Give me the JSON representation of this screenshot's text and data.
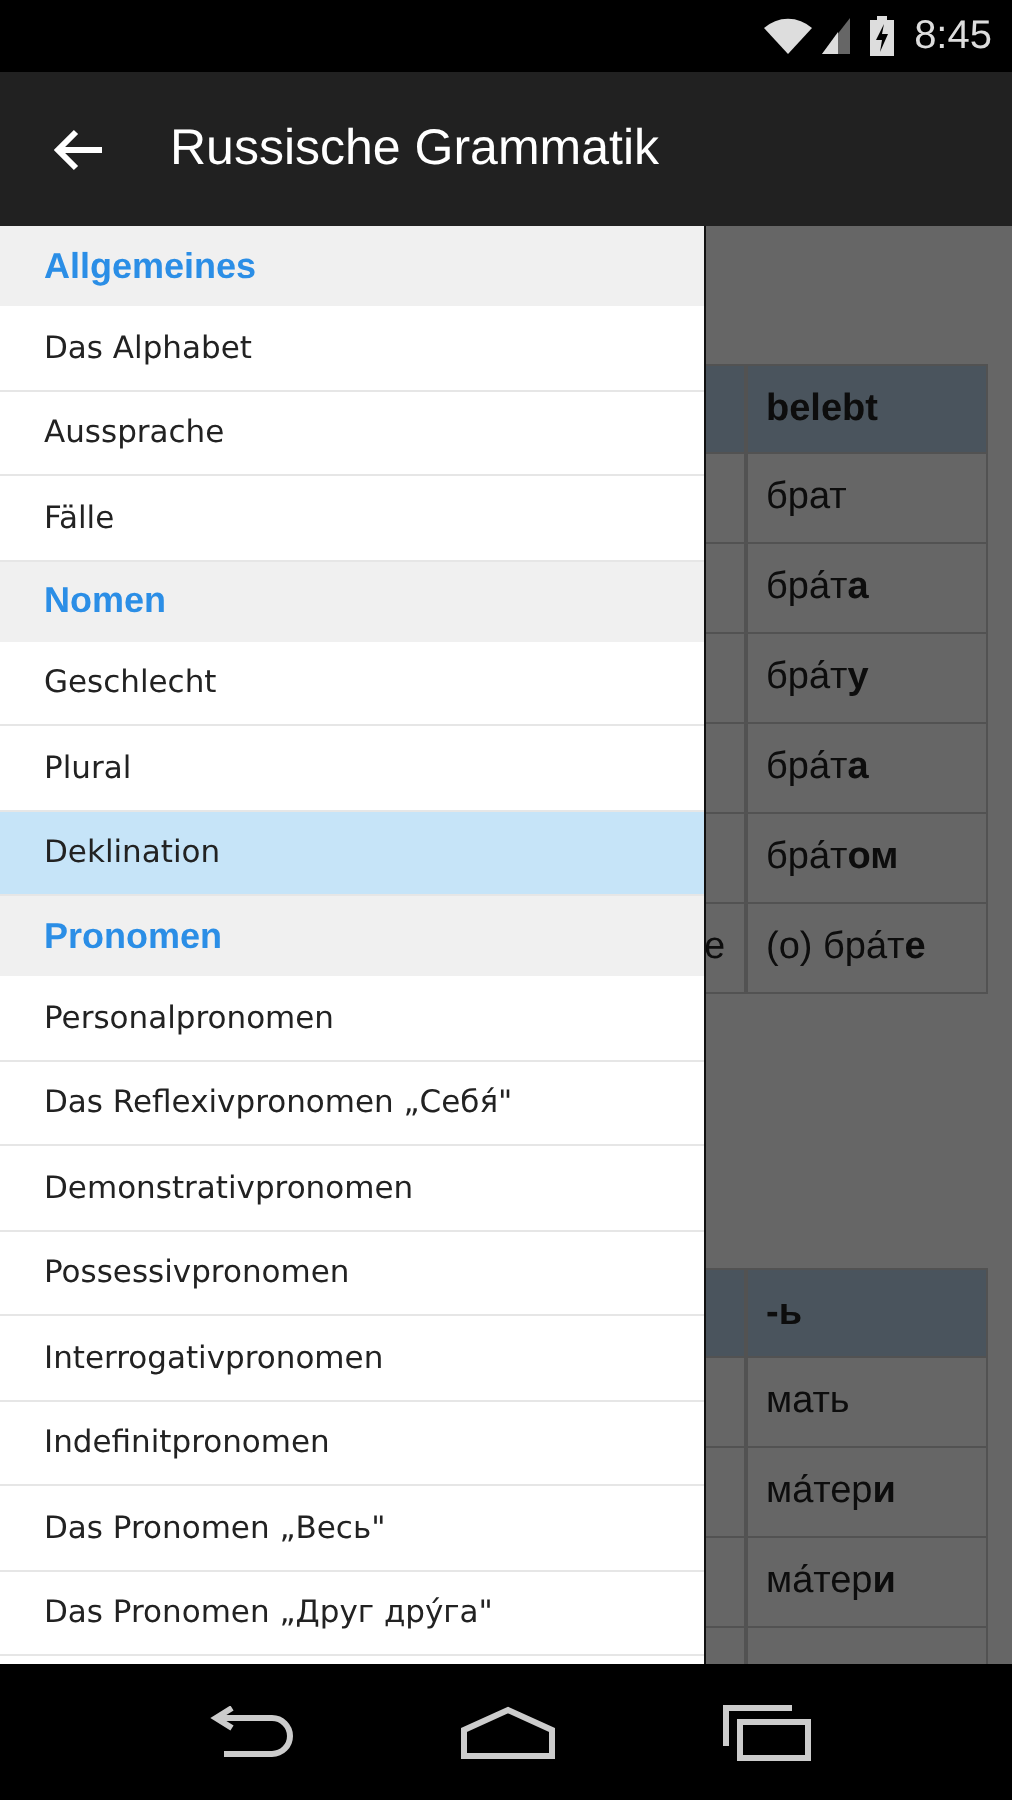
{
  "status_bar": {
    "time": "8:45"
  },
  "app_bar": {
    "title": "Russische Grammatik"
  },
  "content": {
    "tables": [
      {
        "header": {
          "column_2": "belebt"
        },
        "rows": [
          {
            "column_2": "брат"
          },
          {
            "column_2": "бра́т**а**"
          },
          {
            "column_2": "бра́т**у**"
          },
          {
            "column_2": "бра́т**а**"
          },
          {
            "column_2": "бра́т**ом**"
          },
          {
            "column_1": "e",
            "column_2": "(о) бра́т**е**"
          }
        ]
      },
      {
        "header": {
          "column_2": "-ь"
        },
        "rows": [
          {
            "column_2": "мать"
          },
          {
            "column_2": "ма́тер**и**"
          },
          {
            "column_2": "ма́тер**и**"
          },
          {}
        ]
      }
    ]
  },
  "drawer": {
    "items": [
      {
        "kind": "section",
        "label": "Allgemeines"
      },
      {
        "kind": "entry",
        "label": "Das Alphabet",
        "selected": false
      },
      {
        "kind": "entry",
        "label": "Aussprache",
        "selected": false
      },
      {
        "kind": "entry",
        "label": "Fälle",
        "selected": false
      },
      {
        "kind": "section",
        "label": "Nomen"
      },
      {
        "kind": "entry",
        "label": "Geschlecht",
        "selected": false
      },
      {
        "kind": "entry",
        "label": "Plural",
        "selected": false
      },
      {
        "kind": "entry",
        "label": "Deklination",
        "selected": true
      },
      {
        "kind": "section",
        "label": "Pronomen"
      },
      {
        "kind": "entry",
        "label": "Personalpronomen",
        "selected": false
      },
      {
        "kind": "entry",
        "label": "Das Reflexivpronomen „Себя́\"",
        "selected": false
      },
      {
        "kind": "entry",
        "label": "Demonstrativpronomen",
        "selected": false
      },
      {
        "kind": "entry",
        "label": "Possessivpronomen",
        "selected": false
      },
      {
        "kind": "entry",
        "label": "Interrogativpronomen",
        "selected": false
      },
      {
        "kind": "entry",
        "label": "Indefinitpronomen",
        "selected": false
      },
      {
        "kind": "entry",
        "label": "Das Pronomen „Весь\"",
        "selected": false
      },
      {
        "kind": "entry",
        "label": "Das Pronomen „Друг дру́га\"",
        "selected": false
      }
    ]
  }
}
